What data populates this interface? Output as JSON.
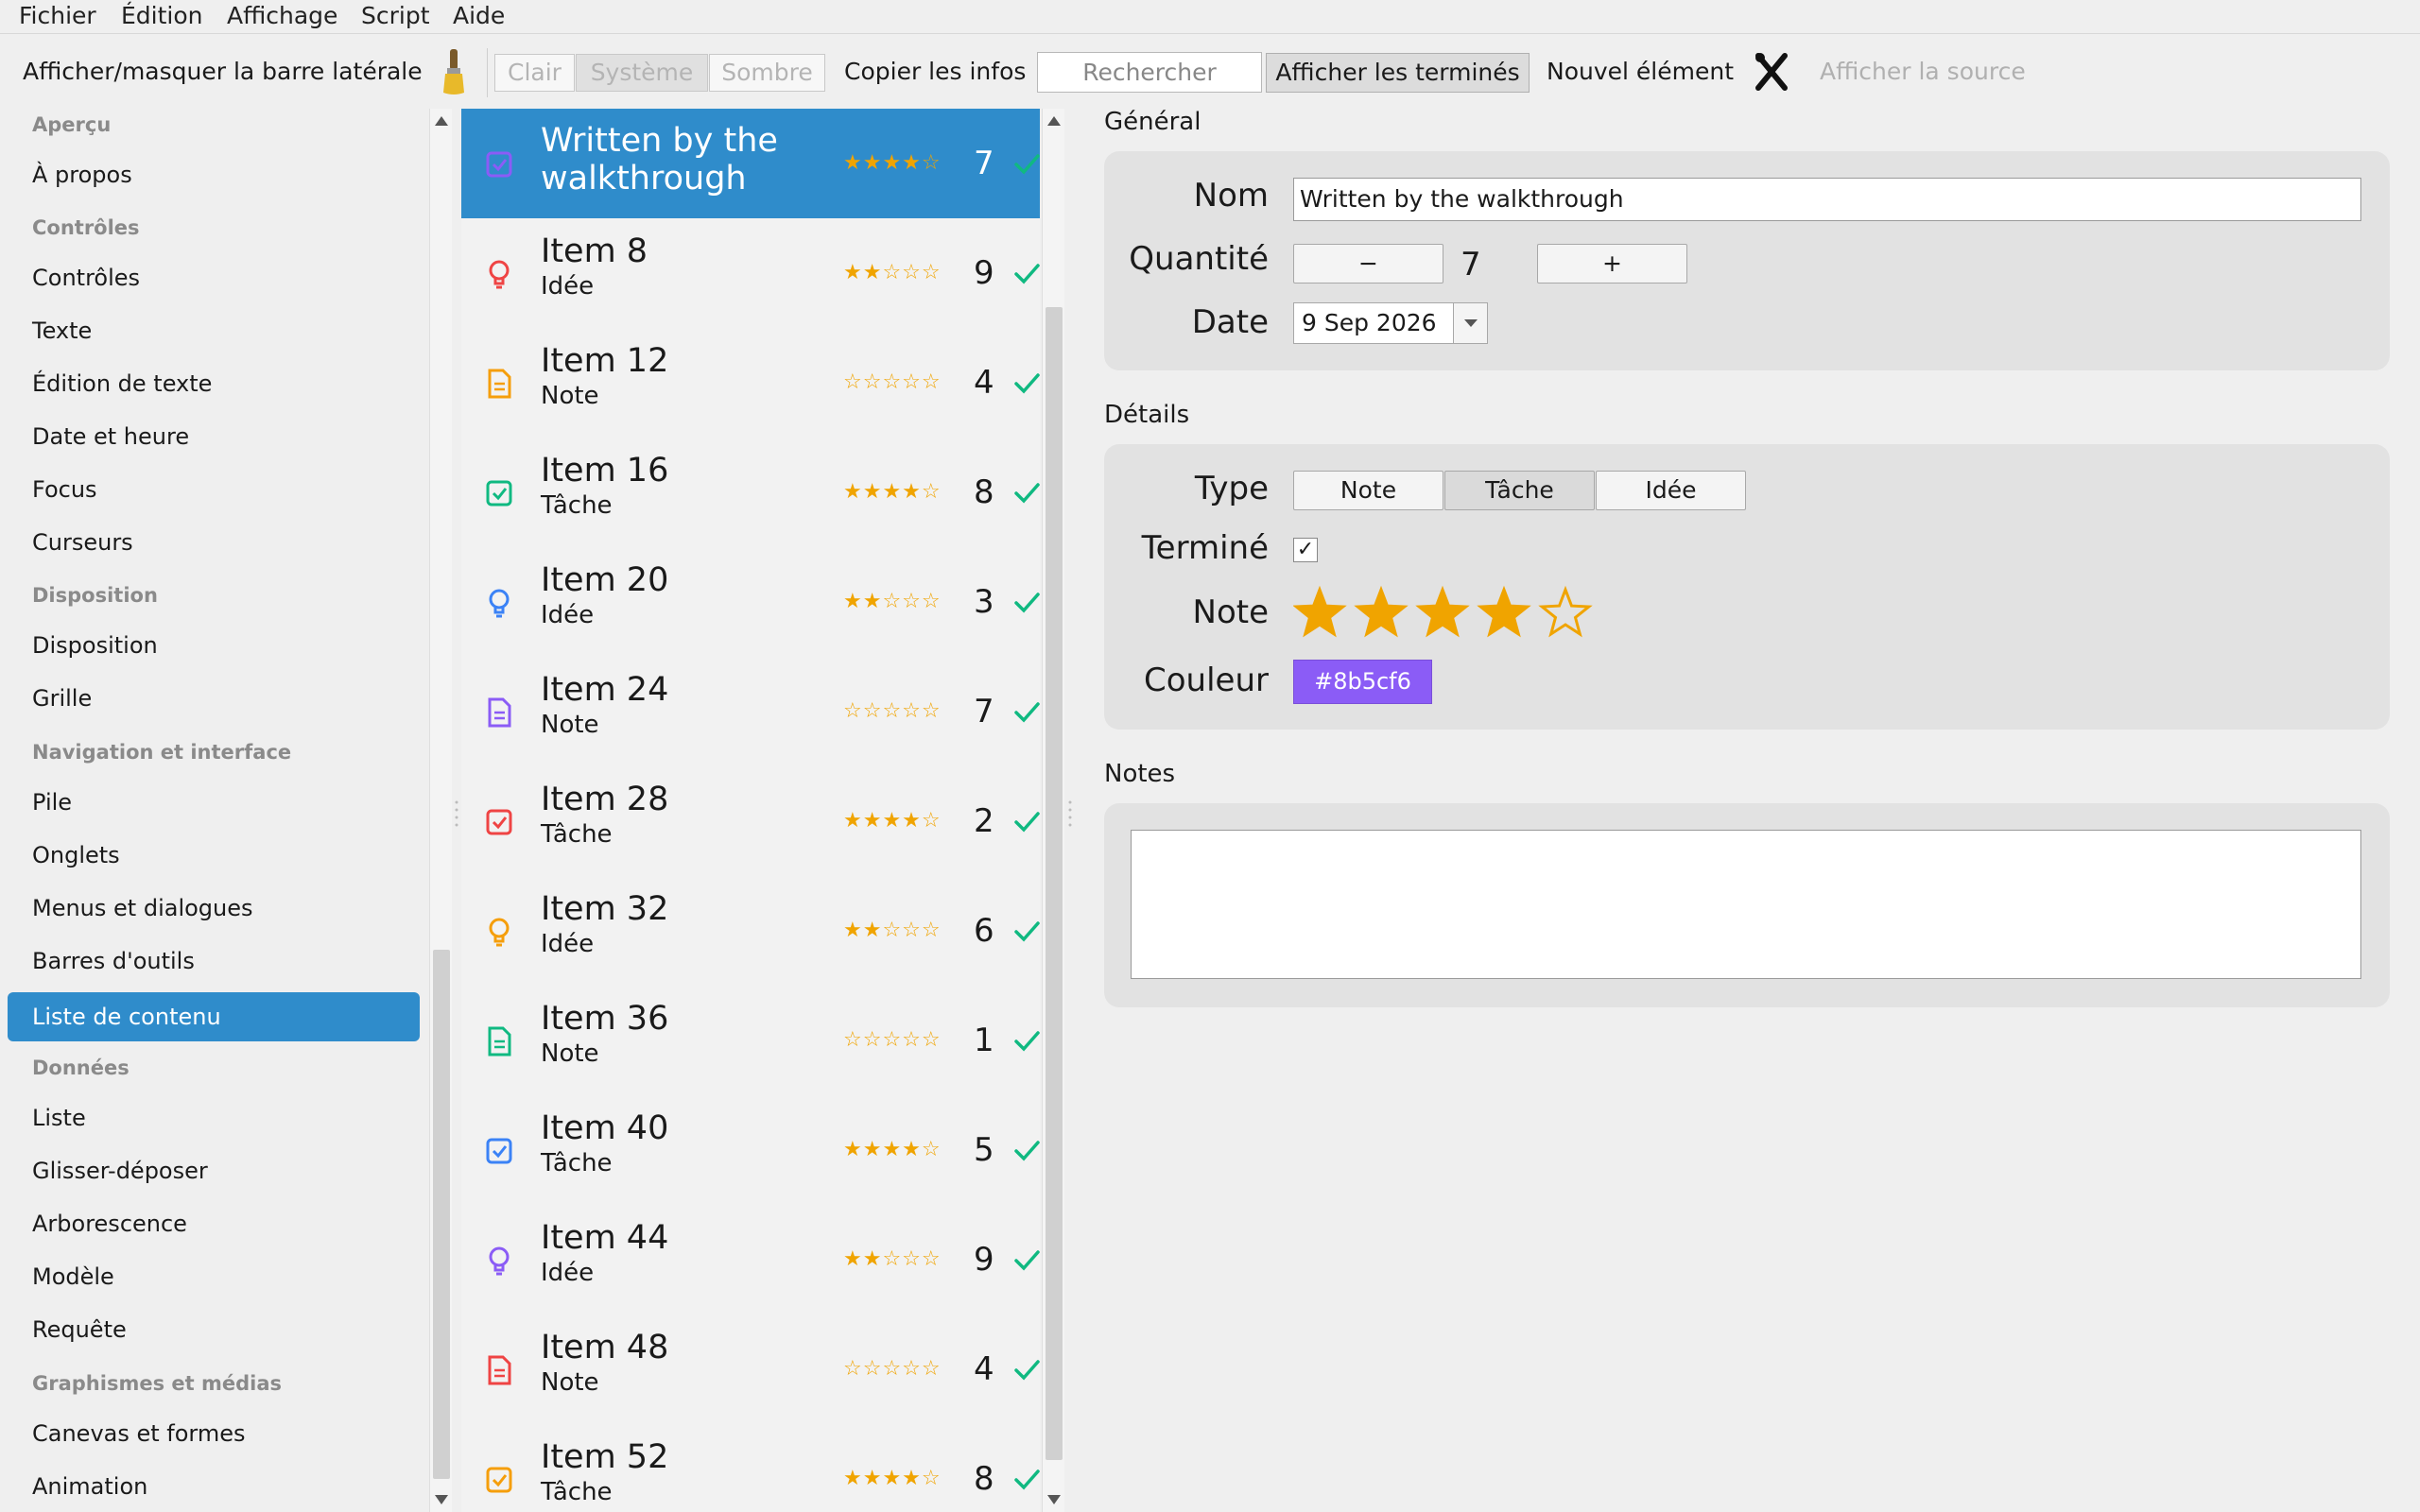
{
  "menu": [
    "Fichier",
    "Édition",
    "Affichage",
    "Script",
    "Aide"
  ],
  "toolbar": {
    "toggle_sidebar": "Afficher/masquer la barre latérale",
    "theme_light": "Clair",
    "theme_system": "Système",
    "theme_dark": "Sombre",
    "copy_info": "Copier les infos",
    "search_placeholder": "Rechercher",
    "show_done": "Afficher les terminés",
    "new_item": "Nouvel élément",
    "show_source": "Afficher la source"
  },
  "sidebar": {
    "groups": [
      {
        "label": "Aperçu",
        "items": [
          "À propos"
        ]
      },
      {
        "label": "Contrôles",
        "items": [
          "Contrôles",
          "Texte",
          "Édition de texte",
          "Date et heure",
          "Focus",
          "Curseurs"
        ]
      },
      {
        "label": "Disposition",
        "items": [
          "Disposition",
          "Grille"
        ]
      },
      {
        "label": "Navigation et interface",
        "items": [
          "Pile",
          "Onglets",
          "Menus et dialogues",
          "Barres d'outils",
          "Liste de contenu"
        ]
      },
      {
        "label": "Données",
        "items": [
          "Liste",
          "Glisser-déposer",
          "Arborescence",
          "Modèle",
          "Requête"
        ]
      },
      {
        "label": "Graphismes et médias",
        "items": [
          "Canevas et formes",
          "Animation"
        ]
      }
    ],
    "selected": "Liste de contenu"
  },
  "list": {
    "rows": [
      {
        "title": "Written by the walkthrough",
        "subtitle": "",
        "kind": "task",
        "rating": 4,
        "qty": "7",
        "color": "#8b5cf6",
        "selected": true
      },
      {
        "title": "Item 8",
        "subtitle": "Idée",
        "kind": "idea",
        "rating": 2,
        "qty": "9",
        "color": "#ef4444"
      },
      {
        "title": "Item 12",
        "subtitle": "Note",
        "kind": "note",
        "rating": 0,
        "qty": "4",
        "color": "#f59e0b"
      },
      {
        "title": "Item 16",
        "subtitle": "Tâche",
        "kind": "task",
        "rating": 4,
        "qty": "8",
        "color": "#10b981"
      },
      {
        "title": "Item 20",
        "subtitle": "Idée",
        "kind": "idea",
        "rating": 2,
        "qty": "3",
        "color": "#3b82f6"
      },
      {
        "title": "Item 24",
        "subtitle": "Note",
        "kind": "note",
        "rating": 0,
        "qty": "7",
        "color": "#8b5cf6"
      },
      {
        "title": "Item 28",
        "subtitle": "Tâche",
        "kind": "task",
        "rating": 4,
        "qty": "2",
        "color": "#ef4444"
      },
      {
        "title": "Item 32",
        "subtitle": "Idée",
        "kind": "idea",
        "rating": 2,
        "qty": "6",
        "color": "#f59e0b"
      },
      {
        "title": "Item 36",
        "subtitle": "Note",
        "kind": "note",
        "rating": 0,
        "qty": "1",
        "color": "#10b981"
      },
      {
        "title": "Item 40",
        "subtitle": "Tâche",
        "kind": "task",
        "rating": 4,
        "qty": "5",
        "color": "#3b82f6"
      },
      {
        "title": "Item 44",
        "subtitle": "Idée",
        "kind": "idea",
        "rating": 2,
        "qty": "9",
        "color": "#8b5cf6"
      },
      {
        "title": "Item 48",
        "subtitle": "Note",
        "kind": "note",
        "rating": 0,
        "qty": "4",
        "color": "#ef4444"
      },
      {
        "title": "Item 52",
        "subtitle": "Tâche",
        "kind": "task",
        "rating": 4,
        "qty": "8",
        "color": "#f59e0b"
      }
    ]
  },
  "detail": {
    "general_title": "Général",
    "name_label": "Nom",
    "name_value": "Written by the walkthrough",
    "qty_label": "Quantité",
    "qty_minus": "−",
    "qty_value": "7",
    "qty_plus": "+",
    "date_label": "Date",
    "date_value": "9 Sep 2026",
    "details_title": "Détails",
    "type_label": "Type",
    "type_options": [
      "Note",
      "Tâche",
      "Idée"
    ],
    "type_selected": "Tâche",
    "done_label": "Terminé",
    "done_mark": "✓",
    "rating_label": "Note",
    "rating_value": 4,
    "rating_max": 5,
    "color_label": "Couleur",
    "color_value": "#8b5cf6",
    "color_text": "#8b5cf6",
    "notes_title": "Notes",
    "notes_value": ""
  },
  "colors": {
    "accent": "#2f8ccb",
    "star": "#f0a400",
    "check": "#10b981"
  }
}
